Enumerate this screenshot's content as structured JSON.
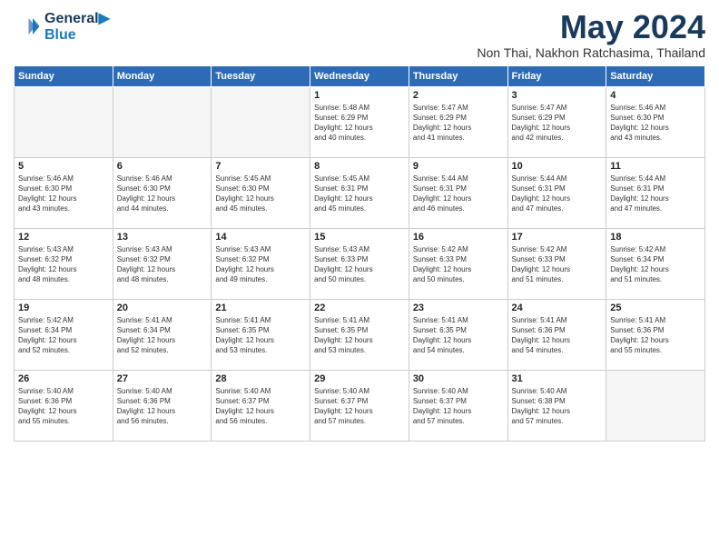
{
  "header": {
    "logo_line1": "General",
    "logo_line2": "Blue",
    "title": "May 2024",
    "subtitle": "Non Thai, Nakhon Ratchasima, Thailand"
  },
  "weekdays": [
    "Sunday",
    "Monday",
    "Tuesday",
    "Wednesday",
    "Thursday",
    "Friday",
    "Saturday"
  ],
  "weeks": [
    [
      {
        "day": "",
        "info": "",
        "empty": true
      },
      {
        "day": "",
        "info": "",
        "empty": true
      },
      {
        "day": "",
        "info": "",
        "empty": true
      },
      {
        "day": "1",
        "info": "Sunrise: 5:48 AM\nSunset: 6:29 PM\nDaylight: 12 hours\nand 40 minutes."
      },
      {
        "day": "2",
        "info": "Sunrise: 5:47 AM\nSunset: 6:29 PM\nDaylight: 12 hours\nand 41 minutes."
      },
      {
        "day": "3",
        "info": "Sunrise: 5:47 AM\nSunset: 6:29 PM\nDaylight: 12 hours\nand 42 minutes."
      },
      {
        "day": "4",
        "info": "Sunrise: 5:46 AM\nSunset: 6:30 PM\nDaylight: 12 hours\nand 43 minutes."
      }
    ],
    [
      {
        "day": "5",
        "info": "Sunrise: 5:46 AM\nSunset: 6:30 PM\nDaylight: 12 hours\nand 43 minutes."
      },
      {
        "day": "6",
        "info": "Sunrise: 5:46 AM\nSunset: 6:30 PM\nDaylight: 12 hours\nand 44 minutes."
      },
      {
        "day": "7",
        "info": "Sunrise: 5:45 AM\nSunset: 6:30 PM\nDaylight: 12 hours\nand 45 minutes."
      },
      {
        "day": "8",
        "info": "Sunrise: 5:45 AM\nSunset: 6:31 PM\nDaylight: 12 hours\nand 45 minutes."
      },
      {
        "day": "9",
        "info": "Sunrise: 5:44 AM\nSunset: 6:31 PM\nDaylight: 12 hours\nand 46 minutes."
      },
      {
        "day": "10",
        "info": "Sunrise: 5:44 AM\nSunset: 6:31 PM\nDaylight: 12 hours\nand 47 minutes."
      },
      {
        "day": "11",
        "info": "Sunrise: 5:44 AM\nSunset: 6:31 PM\nDaylight: 12 hours\nand 47 minutes."
      }
    ],
    [
      {
        "day": "12",
        "info": "Sunrise: 5:43 AM\nSunset: 6:32 PM\nDaylight: 12 hours\nand 48 minutes."
      },
      {
        "day": "13",
        "info": "Sunrise: 5:43 AM\nSunset: 6:32 PM\nDaylight: 12 hours\nand 48 minutes."
      },
      {
        "day": "14",
        "info": "Sunrise: 5:43 AM\nSunset: 6:32 PM\nDaylight: 12 hours\nand 49 minutes."
      },
      {
        "day": "15",
        "info": "Sunrise: 5:43 AM\nSunset: 6:33 PM\nDaylight: 12 hours\nand 50 minutes."
      },
      {
        "day": "16",
        "info": "Sunrise: 5:42 AM\nSunset: 6:33 PM\nDaylight: 12 hours\nand 50 minutes."
      },
      {
        "day": "17",
        "info": "Sunrise: 5:42 AM\nSunset: 6:33 PM\nDaylight: 12 hours\nand 51 minutes."
      },
      {
        "day": "18",
        "info": "Sunrise: 5:42 AM\nSunset: 6:34 PM\nDaylight: 12 hours\nand 51 minutes."
      }
    ],
    [
      {
        "day": "19",
        "info": "Sunrise: 5:42 AM\nSunset: 6:34 PM\nDaylight: 12 hours\nand 52 minutes."
      },
      {
        "day": "20",
        "info": "Sunrise: 5:41 AM\nSunset: 6:34 PM\nDaylight: 12 hours\nand 52 minutes."
      },
      {
        "day": "21",
        "info": "Sunrise: 5:41 AM\nSunset: 6:35 PM\nDaylight: 12 hours\nand 53 minutes."
      },
      {
        "day": "22",
        "info": "Sunrise: 5:41 AM\nSunset: 6:35 PM\nDaylight: 12 hours\nand 53 minutes."
      },
      {
        "day": "23",
        "info": "Sunrise: 5:41 AM\nSunset: 6:35 PM\nDaylight: 12 hours\nand 54 minutes."
      },
      {
        "day": "24",
        "info": "Sunrise: 5:41 AM\nSunset: 6:36 PM\nDaylight: 12 hours\nand 54 minutes."
      },
      {
        "day": "25",
        "info": "Sunrise: 5:41 AM\nSunset: 6:36 PM\nDaylight: 12 hours\nand 55 minutes."
      }
    ],
    [
      {
        "day": "26",
        "info": "Sunrise: 5:40 AM\nSunset: 6:36 PM\nDaylight: 12 hours\nand 55 minutes."
      },
      {
        "day": "27",
        "info": "Sunrise: 5:40 AM\nSunset: 6:36 PM\nDaylight: 12 hours\nand 56 minutes."
      },
      {
        "day": "28",
        "info": "Sunrise: 5:40 AM\nSunset: 6:37 PM\nDaylight: 12 hours\nand 56 minutes."
      },
      {
        "day": "29",
        "info": "Sunrise: 5:40 AM\nSunset: 6:37 PM\nDaylight: 12 hours\nand 57 minutes."
      },
      {
        "day": "30",
        "info": "Sunrise: 5:40 AM\nSunset: 6:37 PM\nDaylight: 12 hours\nand 57 minutes."
      },
      {
        "day": "31",
        "info": "Sunrise: 5:40 AM\nSunset: 6:38 PM\nDaylight: 12 hours\nand 57 minutes."
      },
      {
        "day": "",
        "info": "",
        "empty": true
      }
    ]
  ]
}
